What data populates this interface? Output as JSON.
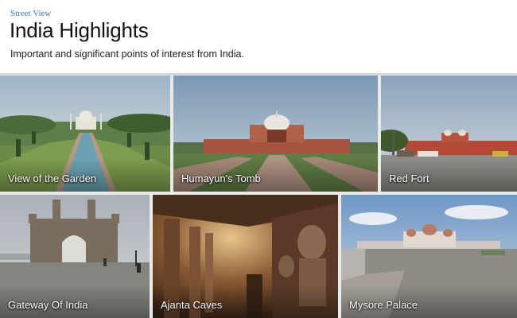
{
  "header": {
    "breadcrumb": "Street View",
    "title": "India Highlights",
    "subtitle": "Important and significant points of interest from India."
  },
  "tiles": [
    {
      "label": "View of the Garden",
      "icon": "taj-mahal-garden-photo"
    },
    {
      "label": "Humayun's Tomb",
      "icon": "humayuns-tomb-photo"
    },
    {
      "label": "Red Fort",
      "icon": "red-fort-photo"
    },
    {
      "label": "Gateway Of India",
      "icon": "gateway-of-india-photo"
    },
    {
      "label": "Ajanta Caves",
      "icon": "ajanta-caves-photo"
    },
    {
      "label": "Mysore Palace",
      "icon": "mysore-palace-photo"
    }
  ],
  "colors": {
    "link": "#3a77c9",
    "selected_outline": "#6a9ce6"
  }
}
